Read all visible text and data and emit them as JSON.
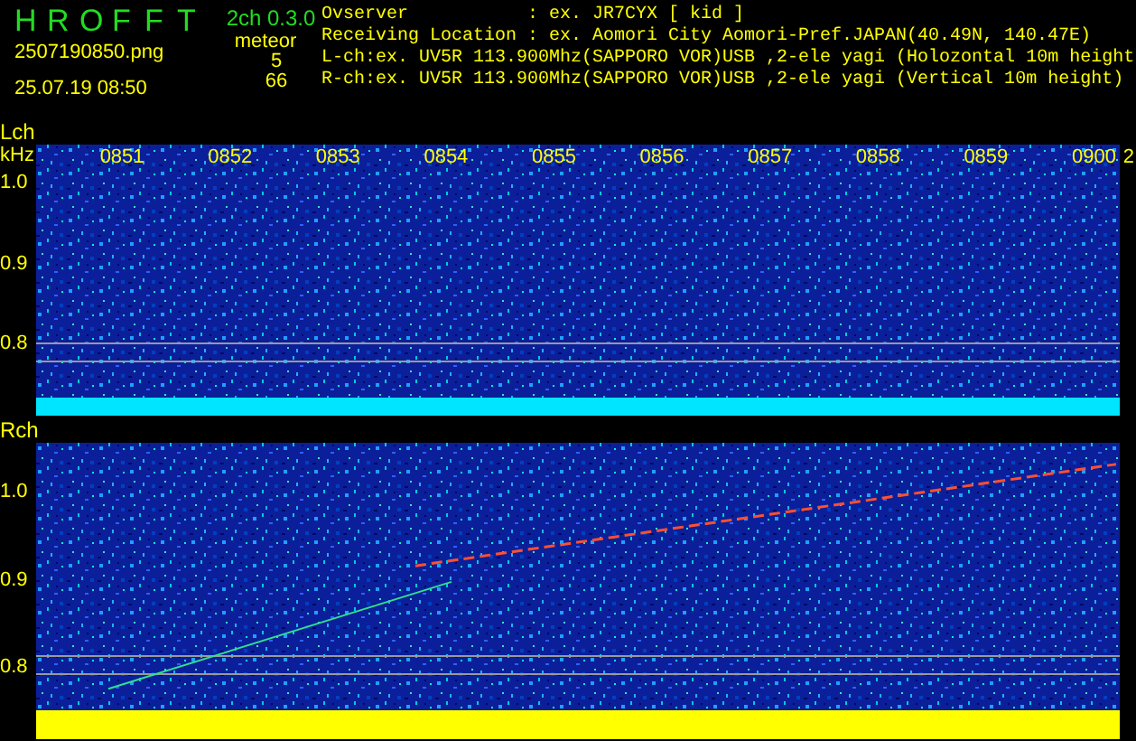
{
  "app": {
    "title_letters": [
      "H",
      "R",
      "O",
      "F",
      "F",
      "T"
    ],
    "version": "2ch 0.3.0",
    "filename": "2507190850.png",
    "datetime": "25.07.19 08:50",
    "meteor_label": "meteor",
    "meteor_counts": [
      "5",
      "66"
    ]
  },
  "info": [
    {
      "kind": "field",
      "label": "Ovserver",
      "value": ": ex. JR7CYX [ kid ]"
    },
    {
      "kind": "field",
      "label": "Receiving Location",
      "value": ": ex. Aomori City Aomori-Pref.JAPAN(40.49N, 140.47E)"
    },
    {
      "kind": "line",
      "text": "L-ch:ex. UV5R 113.900Mhz(SAPPORO VOR)USB ,2-ele yagi (Holozontal 10m height"
    },
    {
      "kind": "line",
      "text": "R-ch:ex. UV5R 113.900Mhz(SAPPORO VOR)USB ,2-ele yagi (Vertical 10m height)"
    }
  ],
  "channels": [
    {
      "label": "Lch",
      "unit": "kHz",
      "ticks": [
        "1.0",
        "0.9",
        "0.8"
      ],
      "time_labels": [
        "0851",
        "0852",
        "0853",
        "0854",
        "0855",
        "0856",
        "0857",
        "0858",
        "0859",
        "0900",
        "2"
      ],
      "meteor": false,
      "color": "#00e5ff"
    },
    {
      "label": "Rch",
      "ticks": [
        "1.0",
        "0.9",
        "0.8"
      ],
      "meteor": true,
      "color": "#ffff00"
    }
  ]
}
